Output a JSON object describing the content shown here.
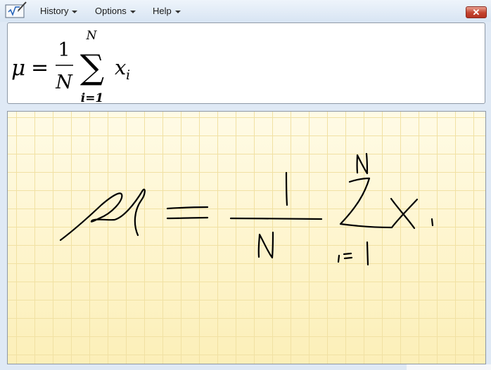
{
  "menu": {
    "history": "History",
    "options": "Options",
    "help": "Help"
  },
  "window": {
    "close_glyph": "✕"
  },
  "preview": {
    "mu": "μ",
    "equals": "=",
    "numerator": "1",
    "denominator": "N",
    "sigma": "∑",
    "upper_limit": "N",
    "lower_limit": "i=1",
    "x": "x",
    "subscript": "i"
  },
  "icons": {
    "app": "math-input-icon",
    "close": "close-icon",
    "dropdown": "chevron-down-icon"
  },
  "colors": {
    "ink": "#000000",
    "grid_background": "#fdf3c4",
    "close_button": "#c4432f"
  }
}
